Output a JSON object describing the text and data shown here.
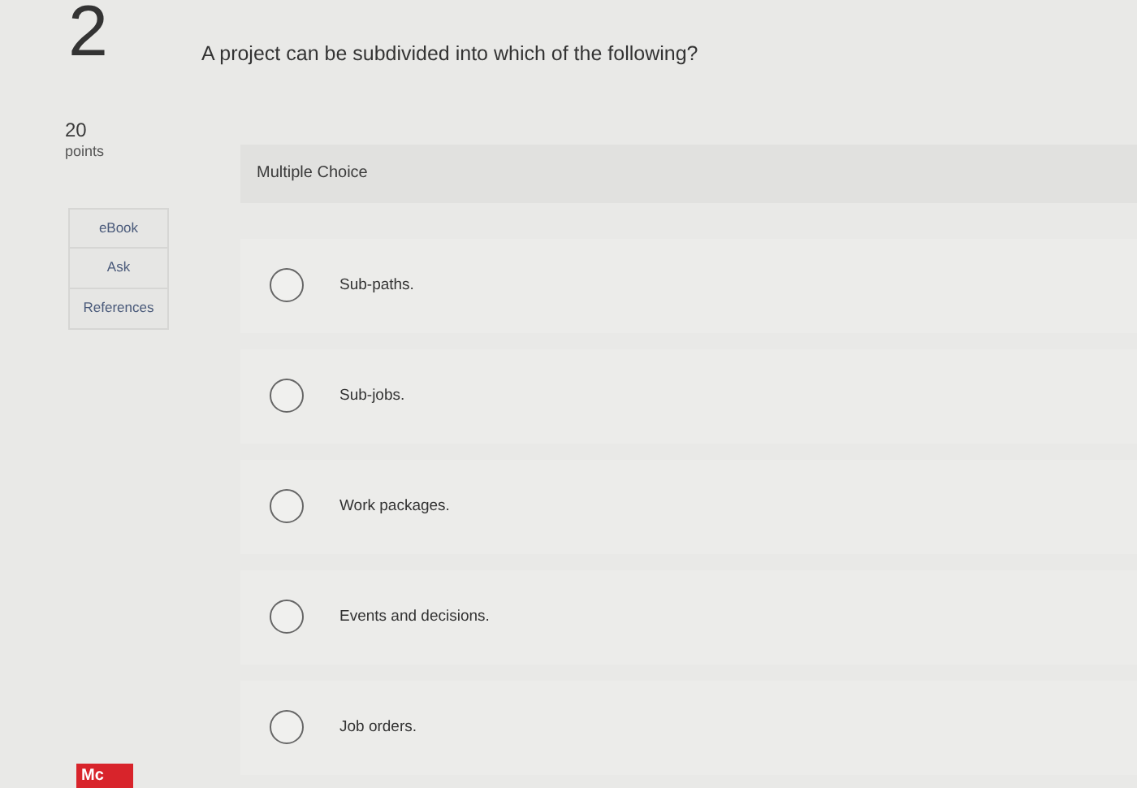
{
  "question": {
    "number": "2",
    "text": "A project can be subdivided into which of the following?",
    "points_value": "20",
    "points_label": "points"
  },
  "tools": [
    "eBook",
    "Ask",
    "References"
  ],
  "answer_area": {
    "type_label": "Multiple Choice",
    "options": [
      {
        "label": "Sub-paths.",
        "selected": false
      },
      {
        "label": "Sub-jobs.",
        "selected": false
      },
      {
        "label": "Work packages.",
        "selected": false
      },
      {
        "label": "Events and decisions.",
        "selected": false
      },
      {
        "label": "Job orders.",
        "selected": false
      }
    ]
  },
  "footer_logo": {
    "text": "Mc"
  }
}
